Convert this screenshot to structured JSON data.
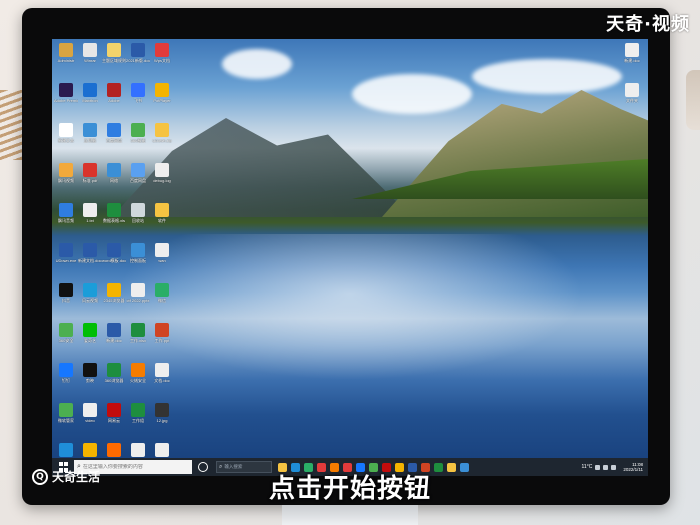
{
  "watermark": {
    "brand_top": "天奇·视频",
    "brand_bottom": "天奇生活"
  },
  "caption": "点击开始按钮",
  "desktop": {
    "icons": [
      {
        "label": "Administr",
        "color": "#d9a441"
      },
      {
        "label": "Winrar",
        "color": "#e6e6e6"
      },
      {
        "label": "主题区域规则",
        "color": "#f2d36b"
      },
      {
        "label": "2021新版.doc",
        "color": "#2b5aa8"
      },
      {
        "label": "Wps文档",
        "color": "#e23b3b"
      },
      {
        "label": "Adobe Premie",
        "color": "#2a1a4f"
      },
      {
        "label": "Maxthon",
        "color": "#1b6fd1"
      },
      {
        "label": "Adobe",
        "color": "#b22222"
      },
      {
        "label": "飞书",
        "color": "#3370ff"
      },
      {
        "label": "PotPlayer",
        "color": "#f4b400"
      },
      {
        "label": "新建文本",
        "color": "#ffffff"
      },
      {
        "label": "此电脑",
        "color": "#3b8fd6"
      },
      {
        "label": "百度网盘",
        "color": "#2f7de1"
      },
      {
        "label": "360极速",
        "color": "#4caf50"
      },
      {
        "label": "UDown.zip",
        "color": "#f5c342"
      },
      {
        "label": "飘讯视频",
        "color": "#f2a93b"
      },
      {
        "label": "标准.pdf",
        "color": "#d9342b"
      },
      {
        "label": "网络",
        "color": "#3b8fd6"
      },
      {
        "label": "百度网盘",
        "color": "#5aa0f0"
      },
      {
        "label": "debug.log",
        "color": "#eeeeee"
      },
      {
        "label": "飘讯音频",
        "color": "#2f7de1"
      },
      {
        "label": "1.txt",
        "color": "#eeeeee"
      },
      {
        "label": "数据表格.xls",
        "color": "#1e8e3e"
      },
      {
        "label": "回收站",
        "color": "#cfd8dc"
      },
      {
        "label": "软件",
        "color": "#f5c342"
      },
      {
        "label": "UDown.exe",
        "color": "#2b5aa8"
      },
      {
        "label": "新建文档.docx",
        "color": "#2b5aa8"
      },
      {
        "label": "word模板.doc",
        "color": "#2b5aa8"
      },
      {
        "label": "控制面板",
        "color": "#3b8fd6"
      },
      {
        "label": "wan",
        "color": "#eeeeee"
      },
      {
        "label": "抖音",
        "color": "#111111"
      },
      {
        "label": "风云视频",
        "color": "#1b9dd9"
      },
      {
        "label": "2345浏览器",
        "color": "#f4b400"
      },
      {
        "label": "ctf 2022.pptx",
        "color": "#eeeeee"
      },
      {
        "label": "微信",
        "color": "#2aae67"
      },
      {
        "label": "360安全",
        "color": "#4caf50"
      },
      {
        "label": "爱奇艺",
        "color": "#00be06"
      },
      {
        "label": "新建.doc",
        "color": "#2b5aa8"
      },
      {
        "label": "工作.xlsx",
        "color": "#1e8e3e"
      },
      {
        "label": "工作.ppt",
        "color": "#d04423"
      },
      {
        "label": "钉钉",
        "color": "#1677ff"
      },
      {
        "label": "剪映",
        "color": "#111111"
      },
      {
        "label": "360浏览器",
        "color": "#1e8e3e"
      },
      {
        "label": "火绒安全",
        "color": "#f57c00"
      },
      {
        "label": "文档.doc",
        "color": "#eeeeee"
      },
      {
        "label": "微软管家",
        "color": "#4caf50"
      },
      {
        "label": "video",
        "color": "#eeeeee"
      },
      {
        "label": "网易云",
        "color": "#c20c0c"
      },
      {
        "label": "工作组",
        "color": "#1e8e3e"
      },
      {
        "label": "12.jpg",
        "color": "#333333"
      },
      {
        "label": "Microsoft Edge",
        "color": "#1f8ed8"
      },
      {
        "label": "PotPlayer 64 bit",
        "color": "#f4b400"
      },
      {
        "label": "百度翻译",
        "color": "#ff6a00"
      },
      {
        "label": "excel模板.xls",
        "color": "#eeeeee"
      },
      {
        "label": "zyquizz.txt",
        "color": "#eeeeee"
      }
    ],
    "right_icons": [
      {
        "label": "新建.doc",
        "color": "#eeeeee"
      },
      {
        "label": "文件夹",
        "color": "#eeeeee"
      }
    ]
  },
  "taskbar": {
    "search_placeholder": "在这里输入你要搜索的内容",
    "search2_text": "输入搜索",
    "apps": [
      "#f5c342",
      "#1f8ed8",
      "#2aae67",
      "#e23b3b",
      "#f57c00",
      "#e23b3b",
      "#1677ff",
      "#4caf50",
      "#c20c0c",
      "#f4b400",
      "#2b5aa8",
      "#d04423",
      "#1e8e3e",
      "#f5c342",
      "#3b8fd6"
    ],
    "weather": "11°C",
    "time": "11:08",
    "date": "2022/1/11"
  }
}
